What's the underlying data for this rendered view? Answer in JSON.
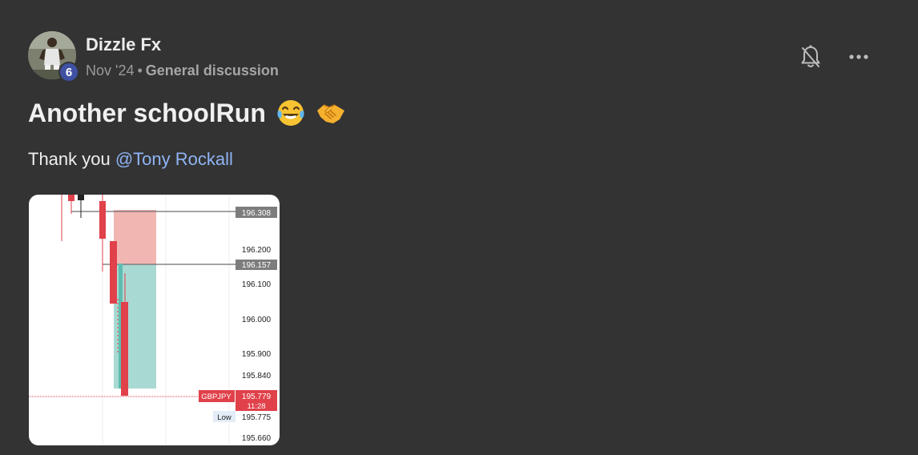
{
  "author": {
    "name": "Dizzle Fx",
    "level": "6"
  },
  "meta": {
    "date": "Nov '24",
    "separator": "•",
    "category": "General discussion"
  },
  "post": {
    "title": "Another schoolRun",
    "body_prefix": "Thank you ",
    "mention": "@Tony Rockall"
  },
  "icons": {
    "notification": "bell-off-icon",
    "more": "more-options-icon",
    "emoji_1": "face-with-tears-of-joy",
    "emoji_2": "handshake"
  },
  "chart_data": {
    "type": "candlestick",
    "symbol": "GBPJPY",
    "price_levels": [
      "196.308",
      "196.200",
      "196.157",
      "196.100",
      "196.000",
      "195.900",
      "195.840",
      "195.779",
      "195.775",
      "195.660"
    ],
    "price_marker": {
      "label": "GBPJPY",
      "price": "195.779",
      "time": "11:28"
    },
    "low_marker": {
      "label": "Low",
      "price": "195.775"
    },
    "position_zones": [
      {
        "type": "stop-loss",
        "from": 196.308,
        "to": 196.157,
        "color": "#f2b6b2"
      },
      {
        "type": "take-profit",
        "from": 196.157,
        "to": 195.84,
        "color": "#a9d9d3"
      }
    ],
    "colors": {
      "bear": "#e0414a",
      "bull": "#ffffff",
      "neutral": "#222222"
    }
  }
}
